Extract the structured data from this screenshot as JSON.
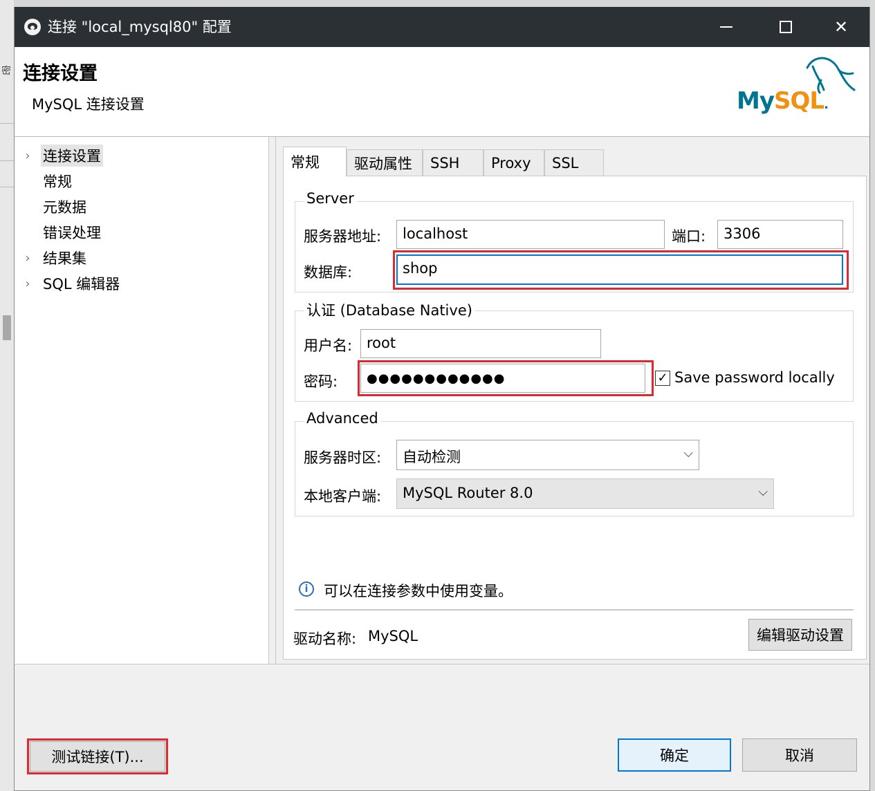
{
  "window": {
    "title": "连接 \"local_mysql80\" 配置",
    "controls": {
      "minimize": "minimize-icon",
      "maximize": "maximize-icon",
      "close": "✕"
    }
  },
  "header": {
    "title": "连接设置",
    "subtitle": "MySQL 连接设置",
    "logo": {
      "part1": "My",
      "part2": "SQL",
      "trademark": "."
    }
  },
  "background": {
    "fragment": "密"
  },
  "sidebar": {
    "items": [
      {
        "label": "连接设置",
        "expandable": true,
        "selected": true
      },
      {
        "label": "常规",
        "expandable": false
      },
      {
        "label": "元数据",
        "expandable": false
      },
      {
        "label": "错误处理",
        "expandable": false
      },
      {
        "label": "结果集",
        "expandable": true
      },
      {
        "label": "SQL 编辑器",
        "expandable": true
      }
    ]
  },
  "tabs": [
    "常规",
    "驱动属性",
    "SSH",
    "Proxy",
    "SSL"
  ],
  "active_tab": "常规",
  "server": {
    "group_title": "Server",
    "host_label": "服务器地址:",
    "host_value": "localhost",
    "port_label": "端口:",
    "port_value": "3306",
    "database_label": "数据库:",
    "database_value": "shop"
  },
  "auth": {
    "group_title": "认证 (Database Native)",
    "username_label": "用户名:",
    "username_value": "root",
    "password_label": "密码:",
    "password_mask": "●●●●●●●●●●●●",
    "save_password_label": "Save password locally",
    "save_password_checked": true
  },
  "advanced": {
    "group_title": "Advanced",
    "timezone_label": "服务器时区:",
    "timezone_value": "自动检测",
    "client_label": "本地客户端:",
    "client_value": "MySQL Router 8.0"
  },
  "info": {
    "text": "可以在连接参数中使用变量。",
    "icon_glyph": "i"
  },
  "driver": {
    "name_label": "驱动名称:",
    "name_value": "MySQL",
    "edit_button": "编辑驱动设置"
  },
  "footer": {
    "test_button": "测试链接(T)...",
    "ok_button": "确定",
    "cancel_button": "取消"
  },
  "colors": {
    "titlebar": "#2b3035",
    "highlight": "#e0292f",
    "focus": "#0078d7",
    "mysql_blue": "#00758f",
    "mysql_orange": "#f29111"
  }
}
